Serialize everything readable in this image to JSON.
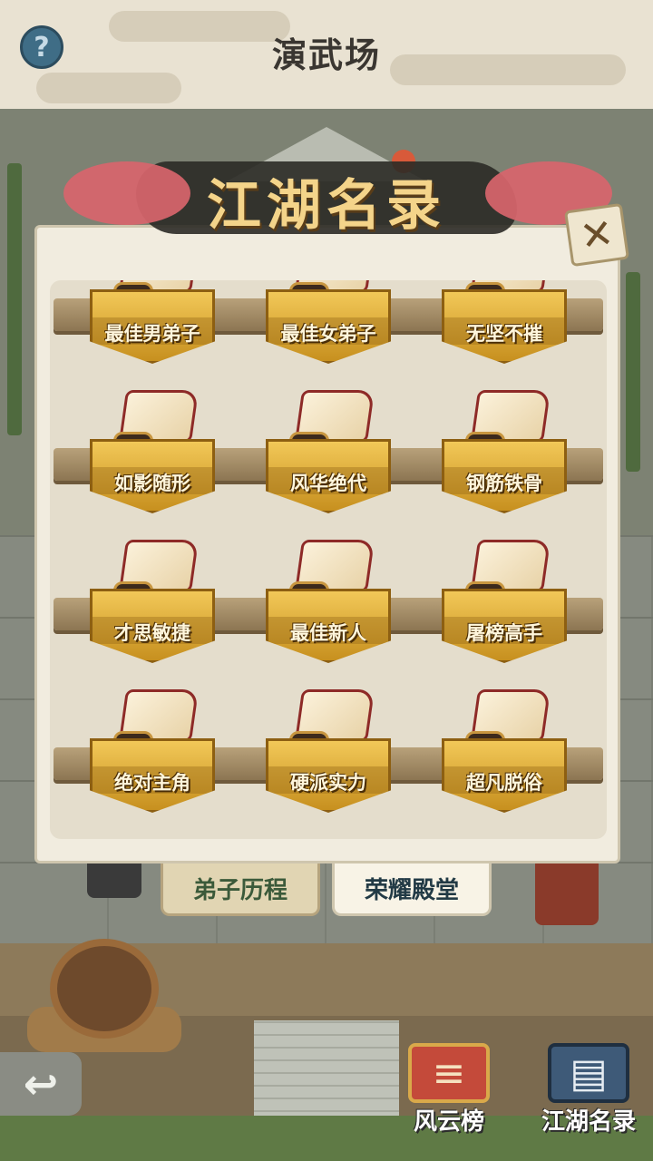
{
  "topbar": {
    "help_icon": "?",
    "title": "演武场"
  },
  "modal": {
    "title": "江湖名录",
    "close_icon": "✕"
  },
  "awards": [
    {
      "label": "最佳男弟子"
    },
    {
      "label": "最佳女弟子"
    },
    {
      "label": "无坚不摧"
    },
    {
      "label": "如影随形"
    },
    {
      "label": "风华绝代"
    },
    {
      "label": "钢筋铁骨"
    },
    {
      "label": "才思敏捷"
    },
    {
      "label": "最佳新人"
    },
    {
      "label": "屠榜高手"
    },
    {
      "label": "绝对主角"
    },
    {
      "label": "硬派实力"
    },
    {
      "label": "超凡脱俗"
    }
  ],
  "tabs": {
    "disciple_history": "弟子历程",
    "hall_of_honor": "荣耀殿堂",
    "active": "荣耀殿堂"
  },
  "bottom_nav": {
    "back_icon": "↩",
    "leaderboard": "风云榜",
    "jianghu_records": "江湖名录"
  },
  "colors": {
    "plaque_gold": "#e0aa35",
    "scroll_red": "#8e2a27",
    "title_gold": "#f4d48a"
  }
}
